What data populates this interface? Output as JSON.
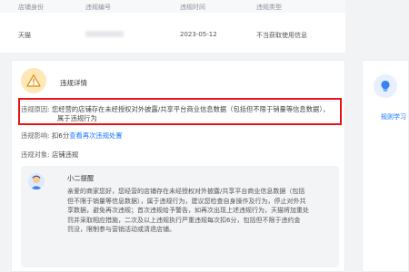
{
  "table": {
    "headers": [
      "店铺身份",
      "违规编号",
      "违规时间",
      "违规类型"
    ],
    "row": {
      "shop": "天猫",
      "violation_id": "",
      "time": "2023-05-12",
      "type": "不当获取使用信息"
    }
  },
  "detail": {
    "title": "违规详情",
    "reason_label": "违规原因:",
    "reason_text": "您经营的店铺存在未经授权对外披露/共享平台商业信息数据（包括但不限于销量等信息数据），",
    "reason_text_2": "属于违规行为",
    "impact_label": "违规影响:",
    "impact_text": "扣6分",
    "impact_link": "查看再次违规处置",
    "target_label": "违规对象:",
    "target_text": "店铺违规"
  },
  "tip": {
    "title": "小二提醒",
    "lines": [
      "亲爱的商家您好，您经营的店铺存在未经授权对外披露/共享平台商业信息数据（包括",
      "但不限于销量等信息数据），属于违规行为，建议您检查自身操作及行为，停止对外共",
      "享数据，避免再次违规；首次违规给予警告，如再次出现上述违规行为，天猫将加重处",
      "罚并采取相应措施，二次及以上违规执行严重违规每次扣6分，包括但不限于违约金",
      "罚没，限制参与营销活动或清退店铺。"
    ]
  },
  "side": {
    "link": "规则学习"
  },
  "colors": {
    "highlight_border": "#e3151b",
    "link": "#1677ff",
    "warning_icon_bg": "#ffe7b8"
  }
}
